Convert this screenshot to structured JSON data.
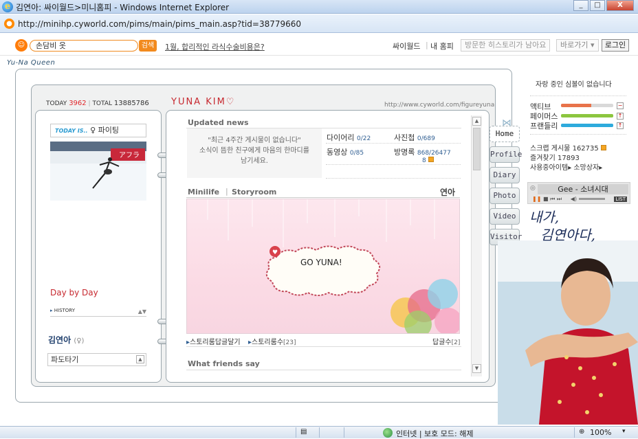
{
  "window": {
    "title": "김연아: 싸이월드>미니홈피 - Windows Internet Explorer",
    "close_label": "X"
  },
  "address": {
    "url": "http://minihp.cyworld.com/pims/main/pims_main.asp?tid=38779660"
  },
  "cybar": {
    "search_value": "손담비 옷",
    "search_button": "검색",
    "ad_link": "1월, 합리적인 라식수술비용은?",
    "cyworld": "싸이월드",
    "my_home": "내 홈피",
    "visited_history": "방문한 히스토리가 남아요",
    "goto": "바로가기",
    "login": "로그인"
  },
  "owner_tag": "Yu-Na Queen",
  "header": {
    "today_label": "TODAY",
    "today_count": "3962",
    "total_label": "TOTAL",
    "total_count": "13885786",
    "title": "YUNA KIM♡",
    "url": "http://www.cyworld.com/figureyuna"
  },
  "left": {
    "today_is_tag": "TODAY IS..",
    "mood": "파이팅",
    "day_by_day": "Day by Day",
    "history": "HISTORY",
    "name": "김연아",
    "gender": "(♀)",
    "wave": "파도타기"
  },
  "news": {
    "title": "Updated news",
    "message_line1": "\"최근 4주간 게시물이 없습니다\"",
    "message_line2": "소식이 뜸한 친구에게 마음의 한마디를",
    "message_line3": "남기세요."
  },
  "stats": {
    "diary_label": "다이어리",
    "diary_count": "0/22",
    "photo_label": "사진첩",
    "photo_count": "0/689",
    "video_label": "동영상",
    "video_count": "0/85",
    "guestbook_label": "방명록",
    "guestbook_count": "868/26477",
    "guestbook_new": "8"
  },
  "miniroom": {
    "tab1": "Minilife",
    "tab2": "Storyroom",
    "owner": "연아",
    "bubble": "GO YUNA!",
    "link1": "스토리룸답글달기",
    "link2": "스토리룸수",
    "link2_count": "[23]",
    "reply_label": "답글수",
    "reply_count": "[2]"
  },
  "friends": {
    "title": "What friends say"
  },
  "nav": {
    "tabs": [
      {
        "label": "Home"
      },
      {
        "label": "Profile"
      },
      {
        "label": "Diary"
      },
      {
        "label": "Photo"
      },
      {
        "label": "Video"
      },
      {
        "label": "Visitor"
      }
    ]
  },
  "sidebar": {
    "no_symbol": "자랑 중인 심볼이 없습니다",
    "active_label": "액티브",
    "famous_label": "페이머스",
    "friendly_label": "프랜들리",
    "active_level": 0.58,
    "famous_level": 1.0,
    "friendly_level": 1.0,
    "scrap_label": "스크랩 게시물",
    "scrap_count": "162735",
    "fav_label": "즐겨찾기",
    "fav_count": "17893",
    "items_label": "사용중아이템",
    "wish_label": "소망상자"
  },
  "music": {
    "song": "Gee - 소녀시대",
    "list_label": "LIST"
  },
  "handwriting": {
    "line1": "내가,",
    "line2": "김연아다,"
  },
  "status": {
    "zone": "인터넷 | 보호 모드: 해제",
    "zoom": "100%"
  },
  "colors": {
    "accent_red": "#c7282f",
    "cy_orange": "#f28a1d",
    "active_meter": "#e8734a",
    "famous_meter": "#8cc63f",
    "friendly_meter": "#2eaadc"
  }
}
